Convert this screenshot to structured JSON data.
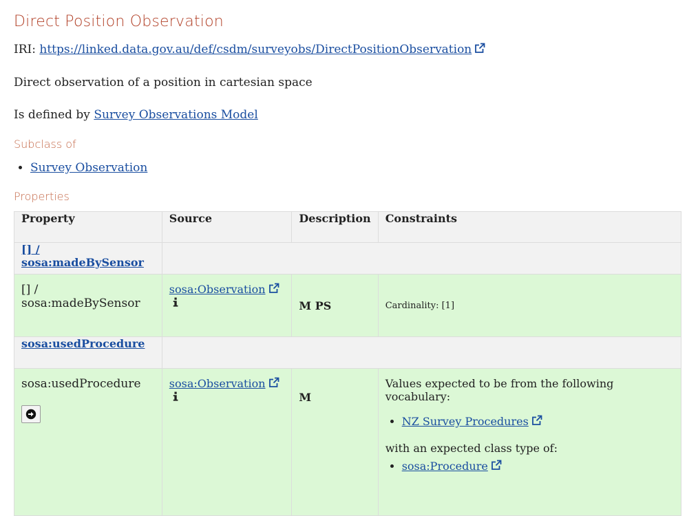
{
  "page": {
    "title": "Direct Position Observation",
    "iri_label": "IRI:",
    "iri": "https://linked.data.gov.au/def/csdm/surveyobs/DirectPositionObservation",
    "description": "Direct observation of a position in cartesian space",
    "defined_by_label": "Is defined by",
    "defined_by": "Survey Observations Model"
  },
  "subclass": {
    "heading": "Subclass of",
    "items": [
      "Survey Observation"
    ]
  },
  "properties": {
    "heading": "Properties",
    "columns": [
      "Property",
      "Source",
      "Description",
      "Constraints"
    ],
    "groups": [
      {
        "link": "[] / sosa:madeBySensor",
        "property": "[] / sosa:madeBySensor",
        "source": "sosa:Observation",
        "description": "M PS",
        "constraints": {
          "text": "Cardinality: [1]"
        }
      },
      {
        "link": "sosa:usedProcedure",
        "property": "sosa:usedProcedure",
        "source": "sosa:Observation",
        "description": "M",
        "constraints": {
          "vocab_text": "Values expected to be from the following vocabulary:",
          "vocab_items": [
            "NZ Survey Procedures"
          ],
          "class_text": "with an expected class type of:",
          "class_items": [
            "sosa:Procedure"
          ]
        }
      }
    ]
  },
  "icons": {
    "external": "external-link-icon",
    "info": "info-icon",
    "go": "arrow-circle-right-icon"
  },
  "colors": {
    "title": "#b24128",
    "heading": "#c56a4a",
    "link": "#1a4ea0",
    "row_green": "#dcf8d6",
    "header_gray": "#f2f2f2"
  }
}
